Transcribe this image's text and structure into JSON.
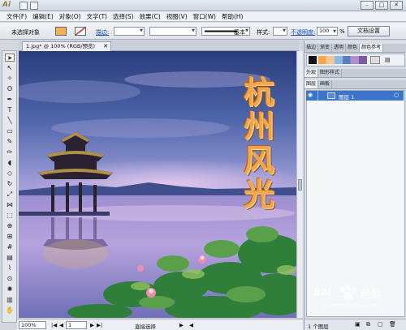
{
  "app": {
    "logo": "Ai"
  },
  "window_controls": [
    "–",
    "□",
    "✕"
  ],
  "menu": [
    "文件(F)",
    "编辑(E)",
    "对象(O)",
    "文字(T)",
    "选择(S)",
    "效果(C)",
    "视图(V)",
    "窗口(W)",
    "帮助(H)"
  ],
  "control_bar": {
    "selection_status": "未选择对象",
    "stroke_label": "描边:",
    "stroke_style": "基本",
    "style_label": "样式:",
    "opacity_label": "不透明度:",
    "opacity_value": "100",
    "opacity_unit": "%",
    "doc_settings_button": "文档设置"
  },
  "document": {
    "tab_title": "1.jpg* @ 100% (RGB/预览)",
    "close": "✕"
  },
  "artwork": {
    "title_chars": [
      "杭",
      "州",
      "风",
      "光"
    ]
  },
  "status_bar": {
    "zoom": "100%",
    "artboard": "1",
    "tool_name": "直接选择"
  },
  "panels": {
    "top_tabs": [
      "描边",
      "渐变",
      "透明",
      "颜色",
      "颜色参考"
    ],
    "appearance_tabs": [
      "外观",
      "图形样式"
    ],
    "layers_tabs": [
      "图层",
      "画板"
    ],
    "layer_name": "图层 1",
    "layer_count": "1 个图层"
  },
  "watermark": {
    "brand": "Bai",
    "text": "经验",
    "url": "jingyan.baidu.com"
  },
  "colors": {
    "fill": "#f3b25a",
    "title_orange": "#f4a54a"
  }
}
